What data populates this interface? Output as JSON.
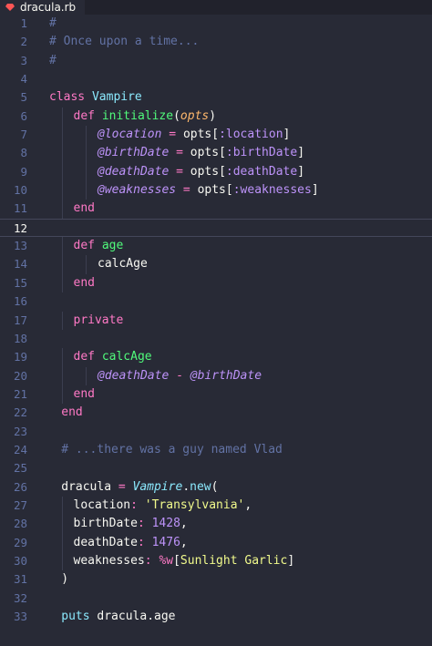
{
  "tab": {
    "filename": "dracula.rb",
    "icon": "ruby-icon",
    "icon_color": "#ff5555"
  },
  "editor": {
    "active_line": 12,
    "lines": [
      {
        "n": "1",
        "indent": 0,
        "tokens": [
          [
            "#",
            "comment"
          ]
        ]
      },
      {
        "n": "2",
        "indent": 0,
        "tokens": [
          [
            "# Once upon a time...",
            "comment"
          ]
        ]
      },
      {
        "n": "3",
        "indent": 0,
        "tokens": [
          [
            "#",
            "comment"
          ]
        ]
      },
      {
        "n": "4",
        "indent": 0,
        "tokens": []
      },
      {
        "n": "5",
        "indent": 0,
        "tokens": [
          [
            "class ",
            "keyword"
          ],
          [
            "Vampire",
            "class"
          ]
        ]
      },
      {
        "n": "6",
        "indent": 1,
        "tokens": [
          [
            "def ",
            "keyword"
          ],
          [
            "initialize",
            "function"
          ],
          [
            "(",
            "plain"
          ],
          [
            "opts",
            "param"
          ],
          [
            ")",
            "plain"
          ]
        ]
      },
      {
        "n": "7",
        "indent": 2,
        "tokens": [
          [
            "@location",
            "ivar"
          ],
          [
            " = ",
            "operator"
          ],
          [
            "opts[",
            "plain"
          ],
          [
            ":location",
            "symbol"
          ],
          [
            "]",
            "plain"
          ]
        ]
      },
      {
        "n": "8",
        "indent": 2,
        "tokens": [
          [
            "@birthDate",
            "ivar"
          ],
          [
            " = ",
            "operator"
          ],
          [
            "opts[",
            "plain"
          ],
          [
            ":birthDate",
            "symbol"
          ],
          [
            "]",
            "plain"
          ]
        ]
      },
      {
        "n": "9",
        "indent": 2,
        "tokens": [
          [
            "@deathDate",
            "ivar"
          ],
          [
            " = ",
            "operator"
          ],
          [
            "opts[",
            "plain"
          ],
          [
            ":deathDate",
            "symbol"
          ],
          [
            "]",
            "plain"
          ]
        ]
      },
      {
        "n": "10",
        "indent": 2,
        "tokens": [
          [
            "@weaknesses",
            "ivar"
          ],
          [
            " = ",
            "operator"
          ],
          [
            "opts[",
            "plain"
          ],
          [
            ":weaknesses",
            "symbol"
          ],
          [
            "]",
            "plain"
          ]
        ]
      },
      {
        "n": "11",
        "indent": 1,
        "tokens": [
          [
            "end",
            "keyword"
          ]
        ]
      },
      {
        "n": "12",
        "indent": 0,
        "tokens": []
      },
      {
        "n": "13",
        "indent": 1,
        "tokens": [
          [
            "def ",
            "keyword"
          ],
          [
            "age",
            "function"
          ]
        ]
      },
      {
        "n": "14",
        "indent": 2,
        "tokens": [
          [
            "calcAge",
            "plain"
          ]
        ]
      },
      {
        "n": "15",
        "indent": 1,
        "tokens": [
          [
            "end",
            "keyword"
          ]
        ]
      },
      {
        "n": "16",
        "indent": 0,
        "tokens": []
      },
      {
        "n": "17",
        "indent": 1,
        "tokens": [
          [
            "private",
            "keyword"
          ]
        ]
      },
      {
        "n": "18",
        "indent": 0,
        "tokens": []
      },
      {
        "n": "19",
        "indent": 1,
        "tokens": [
          [
            "def ",
            "keyword"
          ],
          [
            "calcAge",
            "function"
          ]
        ]
      },
      {
        "n": "20",
        "indent": 2,
        "tokens": [
          [
            "@deathDate",
            "ivar"
          ],
          [
            " - ",
            "operator"
          ],
          [
            "@birthDate",
            "ivar"
          ]
        ]
      },
      {
        "n": "21",
        "indent": 1,
        "tokens": [
          [
            "end",
            "keyword"
          ]
        ]
      },
      {
        "n": "22",
        "indent": 0.5,
        "tokens": [
          [
            "end",
            "keyword"
          ]
        ]
      },
      {
        "n": "23",
        "indent": 0,
        "tokens": []
      },
      {
        "n": "24",
        "indent": 0.5,
        "tokens": [
          [
            "# ...there was a guy named Vlad",
            "comment"
          ]
        ]
      },
      {
        "n": "25",
        "indent": 0,
        "tokens": []
      },
      {
        "n": "26",
        "indent": 0.5,
        "tokens": [
          [
            "dracula",
            "plain"
          ],
          [
            " = ",
            "operator"
          ],
          [
            "Vampire",
            "class-italic"
          ],
          [
            ".",
            "plain"
          ],
          [
            "new",
            "class"
          ],
          [
            "(",
            "plain"
          ]
        ]
      },
      {
        "n": "27",
        "indent": 1,
        "tokens": [
          [
            "location",
            "plain"
          ],
          [
            ": ",
            "operator"
          ],
          [
            "'Transylvania'",
            "string"
          ],
          [
            ",",
            "plain"
          ]
        ]
      },
      {
        "n": "28",
        "indent": 1,
        "tokens": [
          [
            "birthDate",
            "plain"
          ],
          [
            ": ",
            "operator"
          ],
          [
            "1428",
            "number"
          ],
          [
            ",",
            "plain"
          ]
        ]
      },
      {
        "n": "29",
        "indent": 1,
        "tokens": [
          [
            "deathDate",
            "plain"
          ],
          [
            ": ",
            "operator"
          ],
          [
            "1476",
            "number"
          ],
          [
            ",",
            "plain"
          ]
        ]
      },
      {
        "n": "30",
        "indent": 1,
        "tokens": [
          [
            "weaknesses",
            "plain"
          ],
          [
            ": ",
            "operator"
          ],
          [
            "%w",
            "operator"
          ],
          [
            "[",
            "plain"
          ],
          [
            "Sunlight Garlic",
            "string"
          ],
          [
            "]",
            "plain"
          ]
        ]
      },
      {
        "n": "31",
        "indent": 0.5,
        "tokens": [
          [
            ")",
            "plain"
          ]
        ]
      },
      {
        "n": "32",
        "indent": 0,
        "tokens": []
      },
      {
        "n": "33",
        "indent": 0.5,
        "tokens": [
          [
            "puts ",
            "class"
          ],
          [
            "dracula",
            "plain"
          ],
          [
            ".",
            "plain"
          ],
          [
            "age",
            "plain"
          ]
        ]
      }
    ]
  }
}
